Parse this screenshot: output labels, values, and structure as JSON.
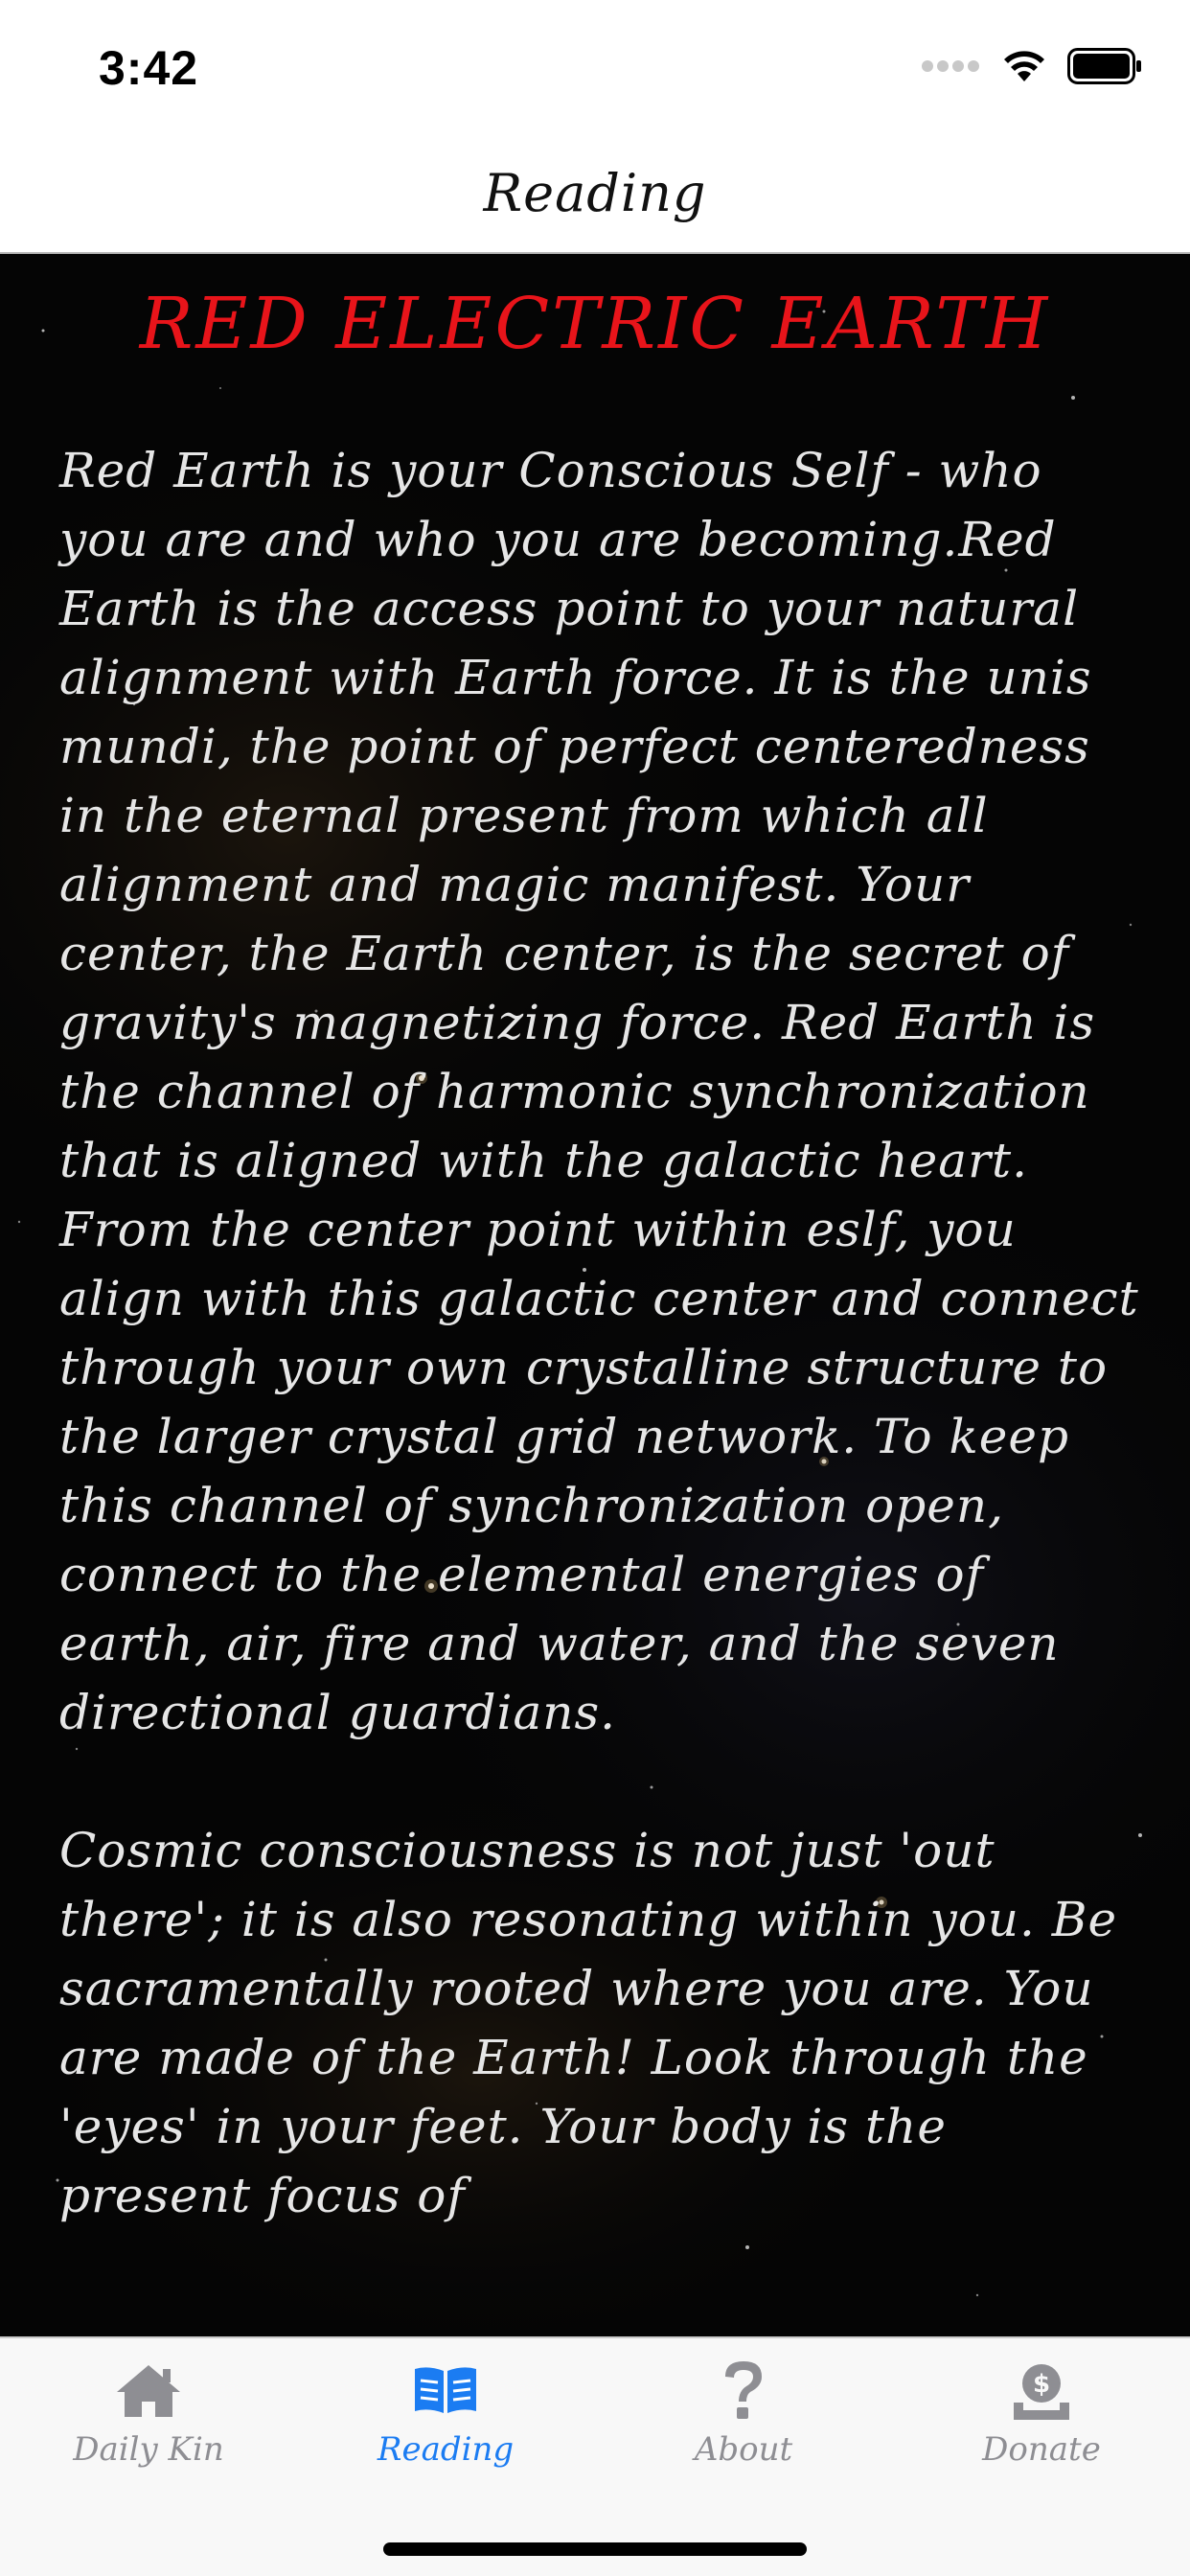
{
  "status_bar": {
    "time": "3:42"
  },
  "nav": {
    "title": "Reading"
  },
  "reading": {
    "title": "RED ELECTRIC EARTH",
    "title_color": "#e8141a",
    "paragraphs": [
      "Red Earth is your Conscious Self - who you are and who you are becoming.Red Earth is the access point to your natural alignment with Earth force. It is the unis mundi, the point of perfect centeredness in the eternal present from which all alignment and magic manifest. Your center, the Earth center, is the secret of gravity's magnetizing force. Red Earth is the channel of harmonic synchronization that is aligned with the galactic heart. From the center point within eslf, you align with this galactic center and connect through your own crystalline structure to the larger crystal grid network. To keep this channel of synchronization open, connect to the elemental energies of earth, air, fire and water, and the seven directional guardians.",
      "Cosmic consciousness is not just 'out there'; it is also resonating within you. Be sacramentally rooted where you are. You are made of the Earth! Look through the 'eyes' in your feet. Your body is the present focus of"
    ]
  },
  "tab_bar": {
    "active_color": "#1b7cf2",
    "inactive_color": "#8e8e93",
    "tabs": [
      {
        "label": "Daily Kin",
        "icon": "home-icon",
        "active": false
      },
      {
        "label": "Reading",
        "icon": "book-icon",
        "active": true
      },
      {
        "label": "About",
        "icon": "question-icon",
        "active": false
      },
      {
        "label": "Donate",
        "icon": "donate-icon",
        "active": false
      }
    ]
  }
}
